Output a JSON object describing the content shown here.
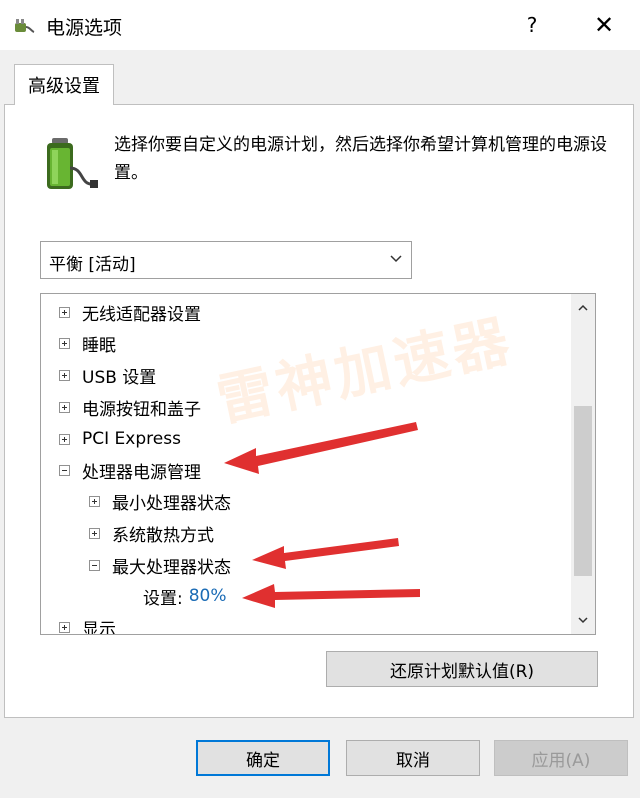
{
  "window": {
    "title": "电源选项",
    "help_label": "?",
    "close_label": "✕"
  },
  "tab": {
    "label": "高级设置"
  },
  "description": "选择你要自定义的电源计划，然后选择你希望计算机管理的电源设置。",
  "plan_select": {
    "value": "平衡 [活动]"
  },
  "tree": {
    "items": [
      {
        "label": "无线适配器设置",
        "expanded": false,
        "level": 0
      },
      {
        "label": "睡眠",
        "expanded": false,
        "level": 0
      },
      {
        "label": "USB 设置",
        "expanded": false,
        "level": 0
      },
      {
        "label": "电源按钮和盖子",
        "expanded": false,
        "level": 0
      },
      {
        "label": "PCI Express",
        "expanded": false,
        "level": 0
      },
      {
        "label": "处理器电源管理",
        "expanded": true,
        "level": 0
      },
      {
        "label": "最小处理器状态",
        "expanded": false,
        "level": 1
      },
      {
        "label": "系统散热方式",
        "expanded": false,
        "level": 1
      },
      {
        "label": "最大处理器状态",
        "expanded": true,
        "level": 1
      },
      {
        "label": "设置:",
        "value": "80%",
        "level": 2
      },
      {
        "label": "显示",
        "expanded": false,
        "level": 0
      }
    ]
  },
  "restore_button": "还原计划默认值(R)",
  "buttons": {
    "ok": "确定",
    "cancel": "取消",
    "apply": "应用(A)"
  },
  "watermark": "雷神加速器",
  "colors": {
    "accent": "#0078d7",
    "value": "#1a6bb5",
    "annotation_arrow": "#e03030"
  },
  "icons": {
    "app": "power-plug-icon",
    "battery": "battery-plug-icon"
  }
}
